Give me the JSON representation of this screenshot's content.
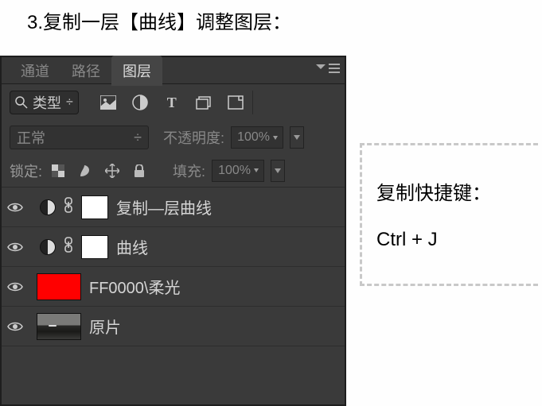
{
  "step_title": "3.复制一层【曲线】调整图层：",
  "tabs": {
    "channels": "通道",
    "paths": "路径",
    "layers": "图层"
  },
  "filter": {
    "kind_label": "类型"
  },
  "blend": {
    "mode": "正常",
    "opacity_label": "不透明度:",
    "opacity_value": "100%"
  },
  "lock": {
    "label": "锁定:",
    "fill_label": "填充:",
    "fill_value": "100%"
  },
  "layers_list": [
    {
      "name": "复制—层曲线"
    },
    {
      "name": "曲线"
    },
    {
      "name": "FF0000\\柔光"
    },
    {
      "name": "原片"
    }
  ],
  "annotation": {
    "line1": "复制快捷键：",
    "line2": "Ctrl + J"
  }
}
